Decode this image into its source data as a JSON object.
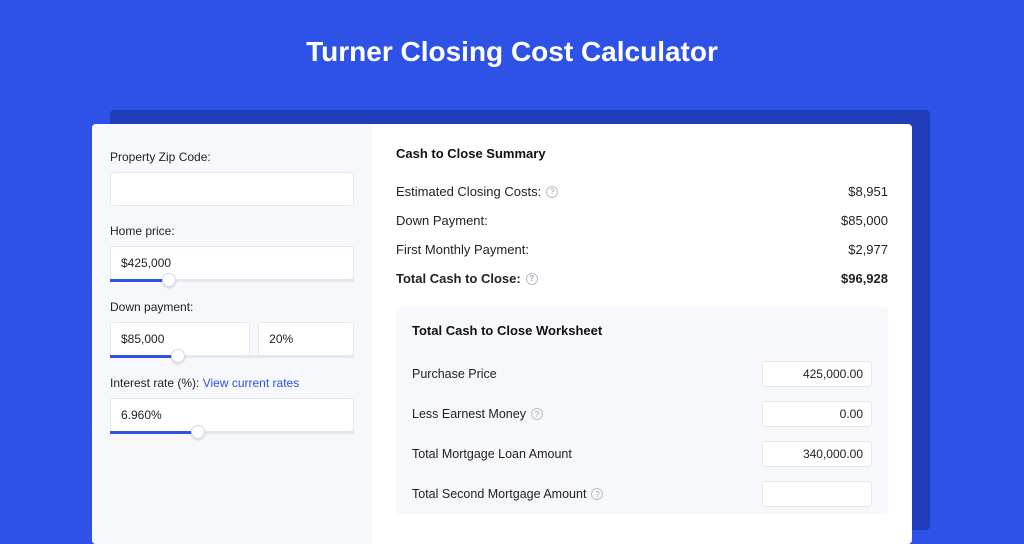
{
  "title": "Turner Closing Cost Calculator",
  "sidebar": {
    "zip_label": "Property Zip Code:",
    "zip_value": "",
    "home_price_label": "Home price:",
    "home_price_value": "$425,000",
    "home_price_slider_pct": 24,
    "down_payment_label": "Down payment:",
    "down_payment_value": "$85,000",
    "down_payment_pct": "20%",
    "down_payment_slider_pct": 28,
    "interest_label": "Interest rate (%):",
    "interest_link": "View current rates",
    "interest_value": "6.960%",
    "interest_slider_pct": 36
  },
  "summary": {
    "heading": "Cash to Close Summary",
    "rows": [
      {
        "label": "Estimated Closing Costs:",
        "help": true,
        "value": "$8,951",
        "bold": false
      },
      {
        "label": "Down Payment:",
        "help": false,
        "value": "$85,000",
        "bold": false
      },
      {
        "label": "First Monthly Payment:",
        "help": false,
        "value": "$2,977",
        "bold": false
      },
      {
        "label": "Total Cash to Close:",
        "help": true,
        "value": "$96,928",
        "bold": true
      }
    ]
  },
  "worksheet": {
    "heading": "Total Cash to Close Worksheet",
    "rows": [
      {
        "label": "Purchase Price",
        "help": false,
        "value": "425,000.00"
      },
      {
        "label": "Less Earnest Money",
        "help": true,
        "value": "0.00"
      },
      {
        "label": "Total Mortgage Loan Amount",
        "help": false,
        "value": "340,000.00"
      },
      {
        "label": "Total Second Mortgage Amount",
        "help": true,
        "value": ""
      }
    ]
  }
}
